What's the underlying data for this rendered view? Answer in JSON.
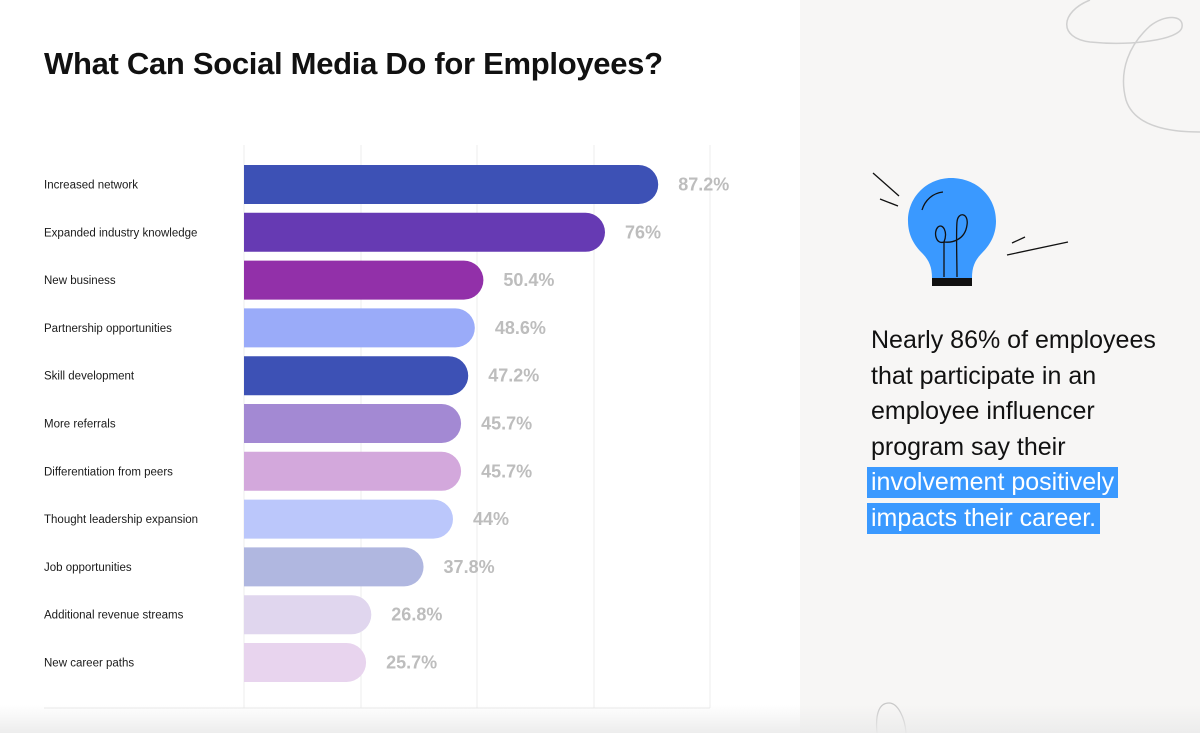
{
  "chart_data": {
    "type": "bar",
    "orientation": "horizontal",
    "title": "What Can Social Media Do for Employees?",
    "xlabel": "",
    "ylabel": "",
    "xlim": [
      0,
      100
    ],
    "grid": true,
    "categories": [
      "Increased network",
      "Expanded industry knowledge",
      "New business",
      "Partnership opportunities",
      "Skill development",
      "More referrals",
      "Differentiation from peers",
      "Thought leadership expansion",
      "Job opportunities",
      "Additional revenue streams",
      "New career paths"
    ],
    "values": [
      87.2,
      76,
      50.4,
      48.6,
      47.2,
      45.7,
      45.7,
      44,
      37.8,
      26.8,
      25.7
    ],
    "value_labels": [
      "87.2%",
      "76%",
      "50.4%",
      "48.6%",
      "47.2%",
      "45.7%",
      "45.7%",
      "44%",
      "37.8%",
      "26.8%",
      "25.7%"
    ],
    "colors": [
      "#3d51b5",
      "#663ab3",
      "#9230a9",
      "#9aabf9",
      "#3d51b5",
      "#a389d3",
      "#d3a8dc",
      "#bbc7fb",
      "#b0b7e0",
      "#e0d6ee",
      "#e8d4ee"
    ],
    "value_label_color": "#bdbdbd"
  },
  "callout": {
    "text_plain": "Nearly 86% of employees that participate in an employee influencer program say their",
    "text_highlight": "involvement positively impacts their career.",
    "highlight_color": "#3a99ff"
  },
  "icons": {
    "lightbulb": "lightbulb-icon",
    "lightbulb_color": "#3a99ff"
  }
}
